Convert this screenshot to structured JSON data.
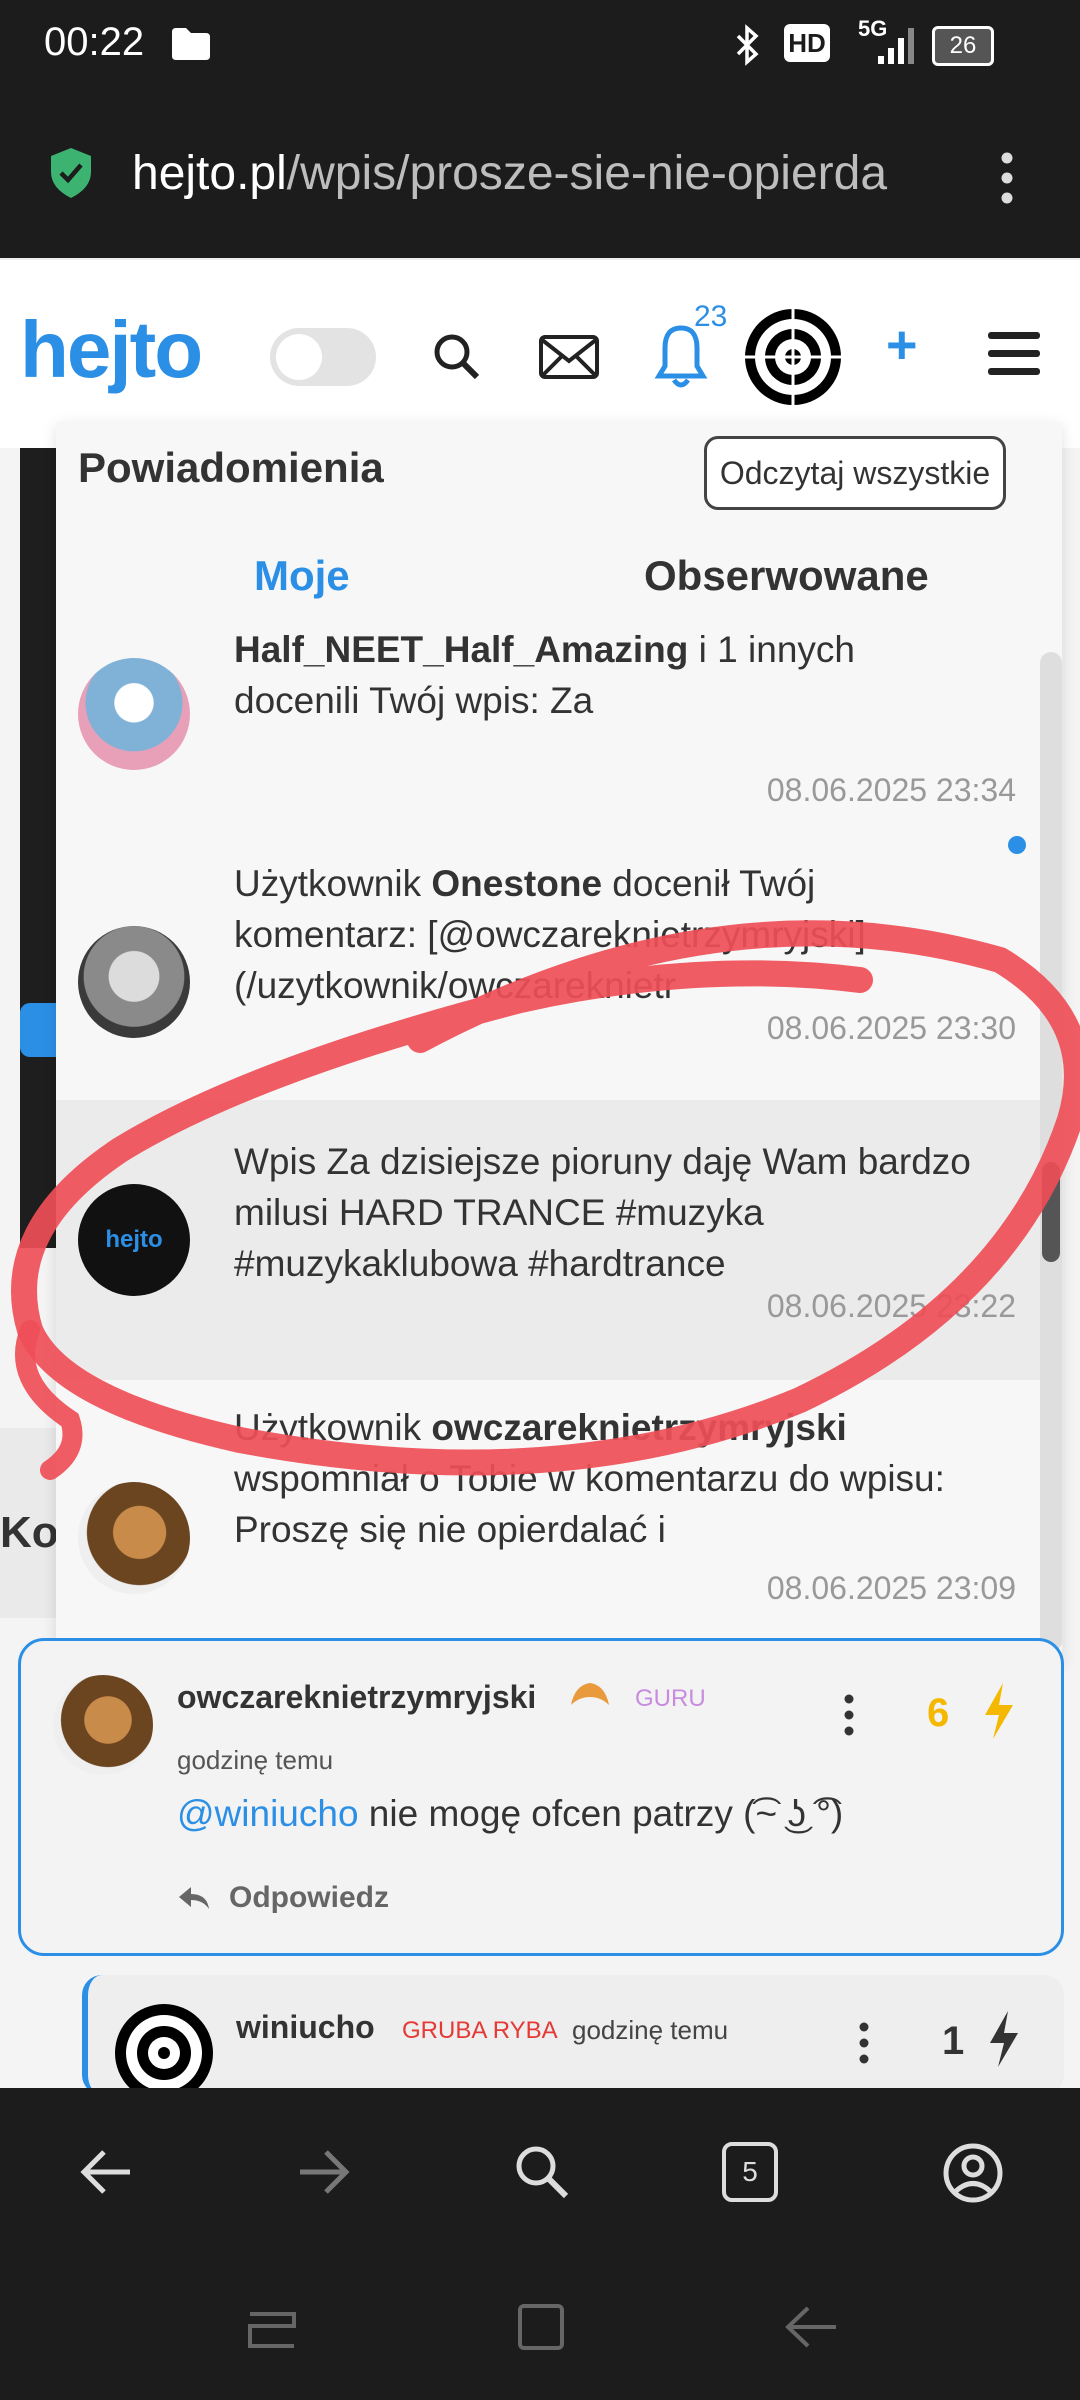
{
  "status_bar": {
    "time": "00:22",
    "network": "5G",
    "hd": "HD",
    "battery": "26"
  },
  "browser": {
    "url_host": "hejto.pl",
    "url_path": "/wpis/prosze-sie-nie-opierda",
    "menu_icon": "kebab-menu-icon"
  },
  "header": {
    "logo": "hejto",
    "notification_count": "23",
    "add_label": "+"
  },
  "behind": {
    "comments_heading": "Ko"
  },
  "notifications": {
    "title": "Powiadomienia",
    "read_all": "Odczytaj wszystkie",
    "tabs": [
      "Moje",
      "Obserwowane"
    ],
    "items": [
      {
        "line1_bold": "Half_NEET_Half_Amazing",
        "line1_rest": " i 1 innych",
        "line2": "docenili Twój wpis: Za",
        "time": "08.06.2025 23:34",
        "unread": false
      },
      {
        "pre": "Użytkownik ",
        "bold": "Onestone",
        "post": " docenił Twój komentarz: [@owczareknietrzymryjski](/uzytkownik/owczareknietr",
        "time": "08.06.2025 23:30",
        "unread": true
      },
      {
        "text": "Wpis Za dzisiejsze pioruny daję Wam bardzo milusi HARD TRANCE #muzyka #muzykaklubowa #hardtrance",
        "time": "08.06.2025 23:22",
        "avatar_text": "hejto"
      },
      {
        "pre": "Użytkownik ",
        "bold": "owczareknietrzymryjski",
        "post": " wspomniał o Tobie w komentarzu do wpisu: Proszę się nie opierdalać i",
        "time": "08.06.2025 23:09"
      }
    ]
  },
  "comments": [
    {
      "author": "owczareknietrzymryjski",
      "badge": "GURU",
      "time": "godzinę temu",
      "mention": "@winiucho",
      "text": " nie mogę ofcen patrzy (͡~ ͜ʖ ͡°)",
      "reply": "Odpowiedz",
      "votes": "6"
    },
    {
      "author": "winiucho",
      "badge": "GRUBA RYBA",
      "time": "godzinę temu",
      "votes": "1"
    }
  ],
  "nav": {
    "tabs_count": "5"
  },
  "colors": {
    "accent": "#2b8fe6",
    "annotation": "#ef4e57",
    "guru": "#c88be0",
    "gruba_ryba": "#e53935",
    "vote": "#f5b800"
  }
}
